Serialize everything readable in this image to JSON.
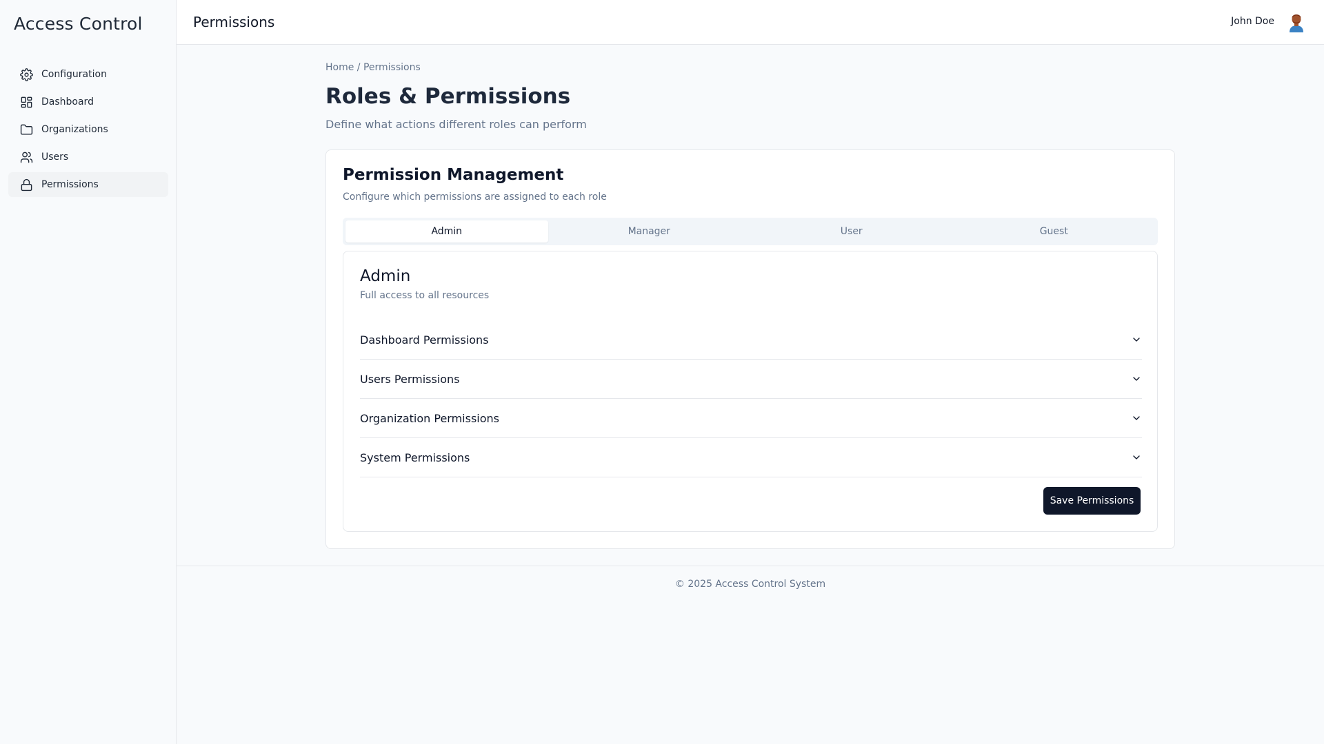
{
  "sidebar": {
    "brand": "Access Control",
    "items": [
      {
        "label": "Configuration",
        "icon": "gear-icon"
      },
      {
        "label": "Dashboard",
        "icon": "dashboard-grid-icon"
      },
      {
        "label": "Organizations",
        "icon": "folder-icon"
      },
      {
        "label": "Users",
        "icon": "users-icon"
      },
      {
        "label": "Permissions",
        "icon": "lock-icon",
        "active": true
      }
    ]
  },
  "header": {
    "title": "Permissions",
    "user_name": "John Doe",
    "avatar_icon": "user-avatar-icon"
  },
  "main": {
    "breadcrumb": "Home / Permissions",
    "title": "Roles & Permissions",
    "subtitle": "Define what actions different roles can perform"
  },
  "card": {
    "title": "Permission Management",
    "subtitle": "Configure which permissions are assigned to each role",
    "tabs": [
      {
        "label": "Admin",
        "active": true
      },
      {
        "label": "Manager"
      },
      {
        "label": "User"
      },
      {
        "label": "Guest"
      }
    ],
    "role": {
      "title": "Admin",
      "description": "Full access to all resources",
      "sections": [
        {
          "label": "Dashboard Permissions"
        },
        {
          "label": "Users Permissions"
        },
        {
          "label": "Organization Permissions"
        },
        {
          "label": "System Permissions"
        }
      ]
    },
    "save_label": "Save Permissions"
  },
  "footer": {
    "text": "© 2025 Access Control System"
  },
  "colors": {
    "primary": "#0f172a",
    "muted_text": "#64748b",
    "border": "#e5e7eb",
    "background": "#f8fafc"
  }
}
